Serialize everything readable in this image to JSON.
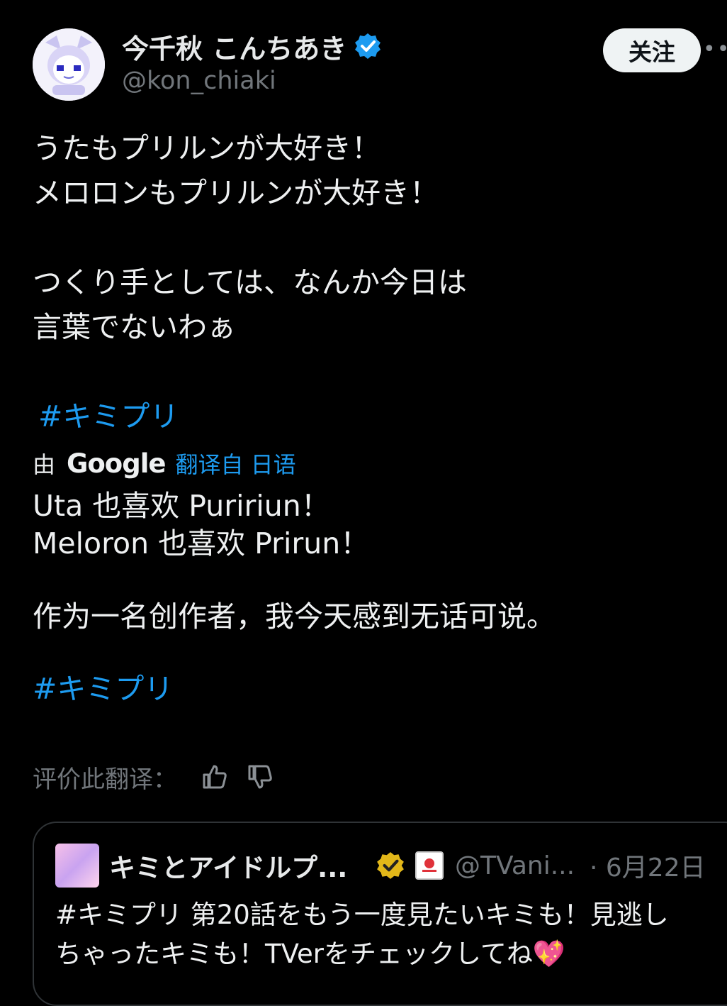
{
  "author": {
    "name": "今千秋 こんちあき",
    "handle": "@kon_chiaki"
  },
  "follow_label": "关注",
  "more_label": "•••",
  "post": {
    "lines": [
      "うたもプリルンが大好き！",
      "メロロンもプリルンが大好き！",
      "つくり手としては、なんか今日は",
      "言葉でないわぁ"
    ],
    "hashtag": "#キミプリ"
  },
  "translation": {
    "by_label": "由",
    "engine": "Google",
    "from_label": "翻译自 日语",
    "lines": [
      "Uta 也喜欢 Puririun！",
      "Meloron 也喜欢 Prirun！",
      "作为一名创作者，我今天感到无话可说。"
    ],
    "hashtag": "#キミプリ",
    "rate_label": "评价此翻译：",
    "like_icon": "thumbs-up-icon",
    "dislike_icon": "thumbs-down-icon"
  },
  "quote": {
    "name": "キミとアイドルプ...",
    "handle": "@TVani...",
    "date": "· 6月22日",
    "lines": [
      "#キミプリ 第20話をもう一度見たいキミも！見逃し",
      "ちゃったキミも！TVerをチェックしてね💖"
    ]
  },
  "colors": {
    "background": "#000000",
    "link": "#1d9bf0",
    "secondary_text": "#71767b",
    "verified_blue": "#1d9bf0",
    "verified_gold": "#e2b719"
  }
}
